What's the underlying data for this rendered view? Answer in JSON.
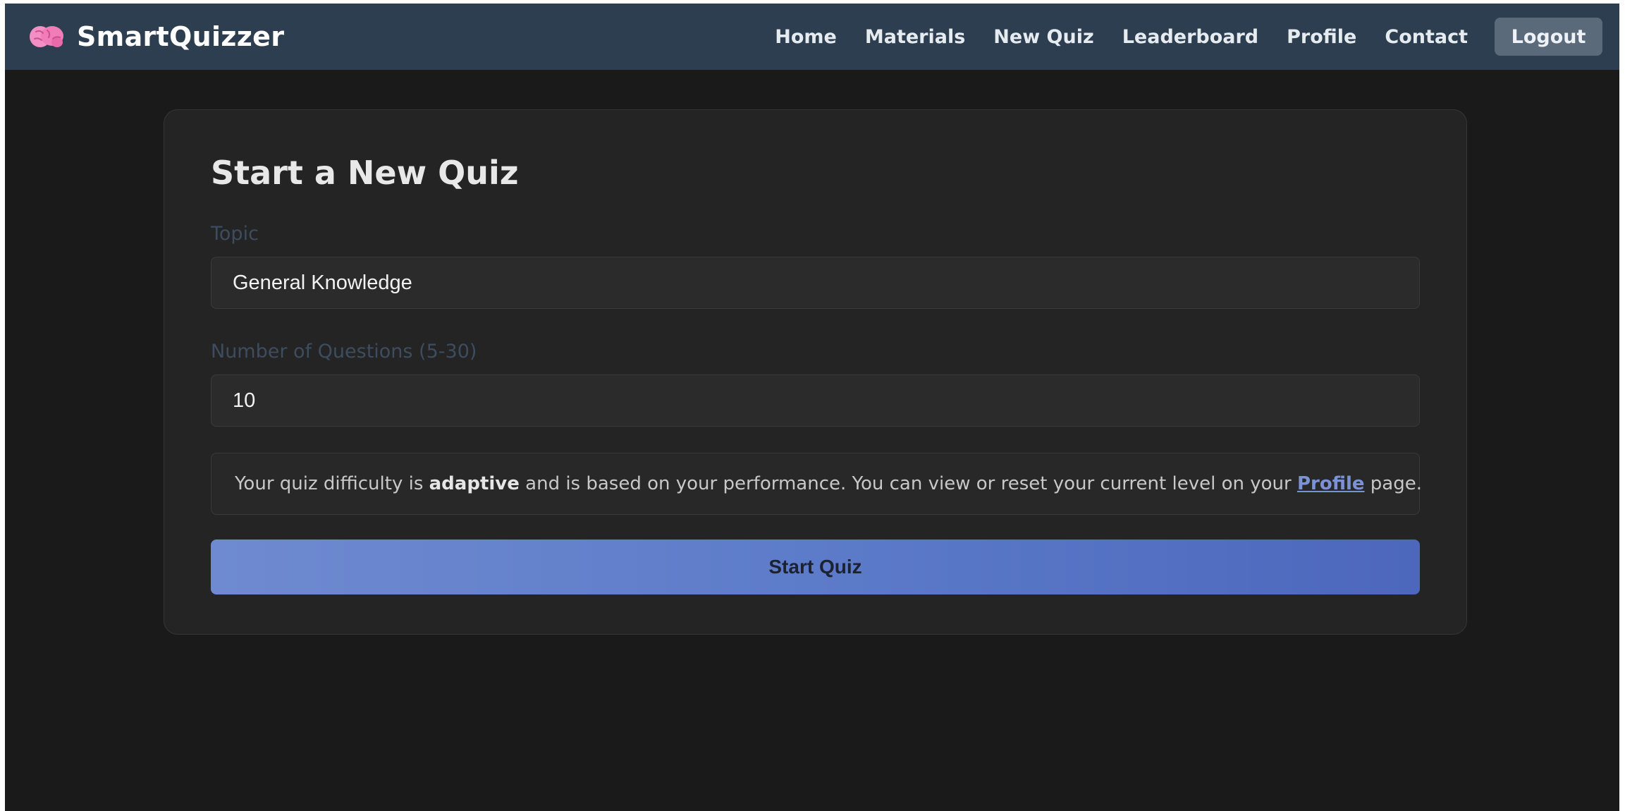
{
  "navbar": {
    "brand_name": "SmartQuizzer",
    "brand_icon": "brain-icon",
    "links": [
      {
        "label": "Home"
      },
      {
        "label": "Materials"
      },
      {
        "label": "New Quiz"
      },
      {
        "label": "Leaderboard"
      },
      {
        "label": "Profile"
      },
      {
        "label": "Contact"
      }
    ],
    "logout_label": "Logout"
  },
  "form": {
    "title": "Start a New Quiz",
    "topic_label": "Topic",
    "topic_value": "General Knowledge",
    "count_label": "Number of Questions (5-30)",
    "count_value": "10",
    "info": {
      "text_before": "Your quiz difficulty is ",
      "emphasis": "adaptive",
      "text_middle": " and is based on your performance. You can view or reset your current level on your ",
      "link_text": "Profile",
      "text_after": " page."
    },
    "submit_label": "Start Quiz"
  },
  "colors": {
    "navbar_bg": "#2c3e50",
    "page_bg": "#1a1a1a",
    "card_bg": "#242424",
    "accent_start": "#6f8ad0",
    "accent_end": "#4c67bc",
    "link": "#7b93d6"
  }
}
